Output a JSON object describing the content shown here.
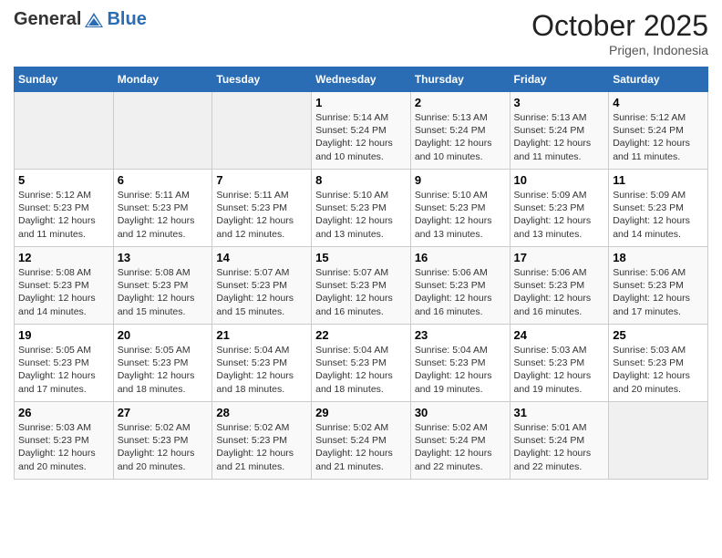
{
  "header": {
    "logo_general": "General",
    "logo_blue": "Blue",
    "month": "October 2025",
    "location": "Prigen, Indonesia"
  },
  "weekdays": [
    "Sunday",
    "Monday",
    "Tuesday",
    "Wednesday",
    "Thursday",
    "Friday",
    "Saturday"
  ],
  "weeks": [
    [
      {
        "day": "",
        "info": ""
      },
      {
        "day": "",
        "info": ""
      },
      {
        "day": "",
        "info": ""
      },
      {
        "day": "1",
        "info": "Sunrise: 5:14 AM\nSunset: 5:24 PM\nDaylight: 12 hours\nand 10 minutes."
      },
      {
        "day": "2",
        "info": "Sunrise: 5:13 AM\nSunset: 5:24 PM\nDaylight: 12 hours\nand 10 minutes."
      },
      {
        "day": "3",
        "info": "Sunrise: 5:13 AM\nSunset: 5:24 PM\nDaylight: 12 hours\nand 11 minutes."
      },
      {
        "day": "4",
        "info": "Sunrise: 5:12 AM\nSunset: 5:24 PM\nDaylight: 12 hours\nand 11 minutes."
      }
    ],
    [
      {
        "day": "5",
        "info": "Sunrise: 5:12 AM\nSunset: 5:23 PM\nDaylight: 12 hours\nand 11 minutes."
      },
      {
        "day": "6",
        "info": "Sunrise: 5:11 AM\nSunset: 5:23 PM\nDaylight: 12 hours\nand 12 minutes."
      },
      {
        "day": "7",
        "info": "Sunrise: 5:11 AM\nSunset: 5:23 PM\nDaylight: 12 hours\nand 12 minutes."
      },
      {
        "day": "8",
        "info": "Sunrise: 5:10 AM\nSunset: 5:23 PM\nDaylight: 12 hours\nand 13 minutes."
      },
      {
        "day": "9",
        "info": "Sunrise: 5:10 AM\nSunset: 5:23 PM\nDaylight: 12 hours\nand 13 minutes."
      },
      {
        "day": "10",
        "info": "Sunrise: 5:09 AM\nSunset: 5:23 PM\nDaylight: 12 hours\nand 13 minutes."
      },
      {
        "day": "11",
        "info": "Sunrise: 5:09 AM\nSunset: 5:23 PM\nDaylight: 12 hours\nand 14 minutes."
      }
    ],
    [
      {
        "day": "12",
        "info": "Sunrise: 5:08 AM\nSunset: 5:23 PM\nDaylight: 12 hours\nand 14 minutes."
      },
      {
        "day": "13",
        "info": "Sunrise: 5:08 AM\nSunset: 5:23 PM\nDaylight: 12 hours\nand 15 minutes."
      },
      {
        "day": "14",
        "info": "Sunrise: 5:07 AM\nSunset: 5:23 PM\nDaylight: 12 hours\nand 15 minutes."
      },
      {
        "day": "15",
        "info": "Sunrise: 5:07 AM\nSunset: 5:23 PM\nDaylight: 12 hours\nand 16 minutes."
      },
      {
        "day": "16",
        "info": "Sunrise: 5:06 AM\nSunset: 5:23 PM\nDaylight: 12 hours\nand 16 minutes."
      },
      {
        "day": "17",
        "info": "Sunrise: 5:06 AM\nSunset: 5:23 PM\nDaylight: 12 hours\nand 16 minutes."
      },
      {
        "day": "18",
        "info": "Sunrise: 5:06 AM\nSunset: 5:23 PM\nDaylight: 12 hours\nand 17 minutes."
      }
    ],
    [
      {
        "day": "19",
        "info": "Sunrise: 5:05 AM\nSunset: 5:23 PM\nDaylight: 12 hours\nand 17 minutes."
      },
      {
        "day": "20",
        "info": "Sunrise: 5:05 AM\nSunset: 5:23 PM\nDaylight: 12 hours\nand 18 minutes."
      },
      {
        "day": "21",
        "info": "Sunrise: 5:04 AM\nSunset: 5:23 PM\nDaylight: 12 hours\nand 18 minutes."
      },
      {
        "day": "22",
        "info": "Sunrise: 5:04 AM\nSunset: 5:23 PM\nDaylight: 12 hours\nand 18 minutes."
      },
      {
        "day": "23",
        "info": "Sunrise: 5:04 AM\nSunset: 5:23 PM\nDaylight: 12 hours\nand 19 minutes."
      },
      {
        "day": "24",
        "info": "Sunrise: 5:03 AM\nSunset: 5:23 PM\nDaylight: 12 hours\nand 19 minutes."
      },
      {
        "day": "25",
        "info": "Sunrise: 5:03 AM\nSunset: 5:23 PM\nDaylight: 12 hours\nand 20 minutes."
      }
    ],
    [
      {
        "day": "26",
        "info": "Sunrise: 5:03 AM\nSunset: 5:23 PM\nDaylight: 12 hours\nand 20 minutes."
      },
      {
        "day": "27",
        "info": "Sunrise: 5:02 AM\nSunset: 5:23 PM\nDaylight: 12 hours\nand 20 minutes."
      },
      {
        "day": "28",
        "info": "Sunrise: 5:02 AM\nSunset: 5:23 PM\nDaylight: 12 hours\nand 21 minutes."
      },
      {
        "day": "29",
        "info": "Sunrise: 5:02 AM\nSunset: 5:24 PM\nDaylight: 12 hours\nand 21 minutes."
      },
      {
        "day": "30",
        "info": "Sunrise: 5:02 AM\nSunset: 5:24 PM\nDaylight: 12 hours\nand 22 minutes."
      },
      {
        "day": "31",
        "info": "Sunrise: 5:01 AM\nSunset: 5:24 PM\nDaylight: 12 hours\nand 22 minutes."
      },
      {
        "day": "",
        "info": ""
      }
    ]
  ]
}
